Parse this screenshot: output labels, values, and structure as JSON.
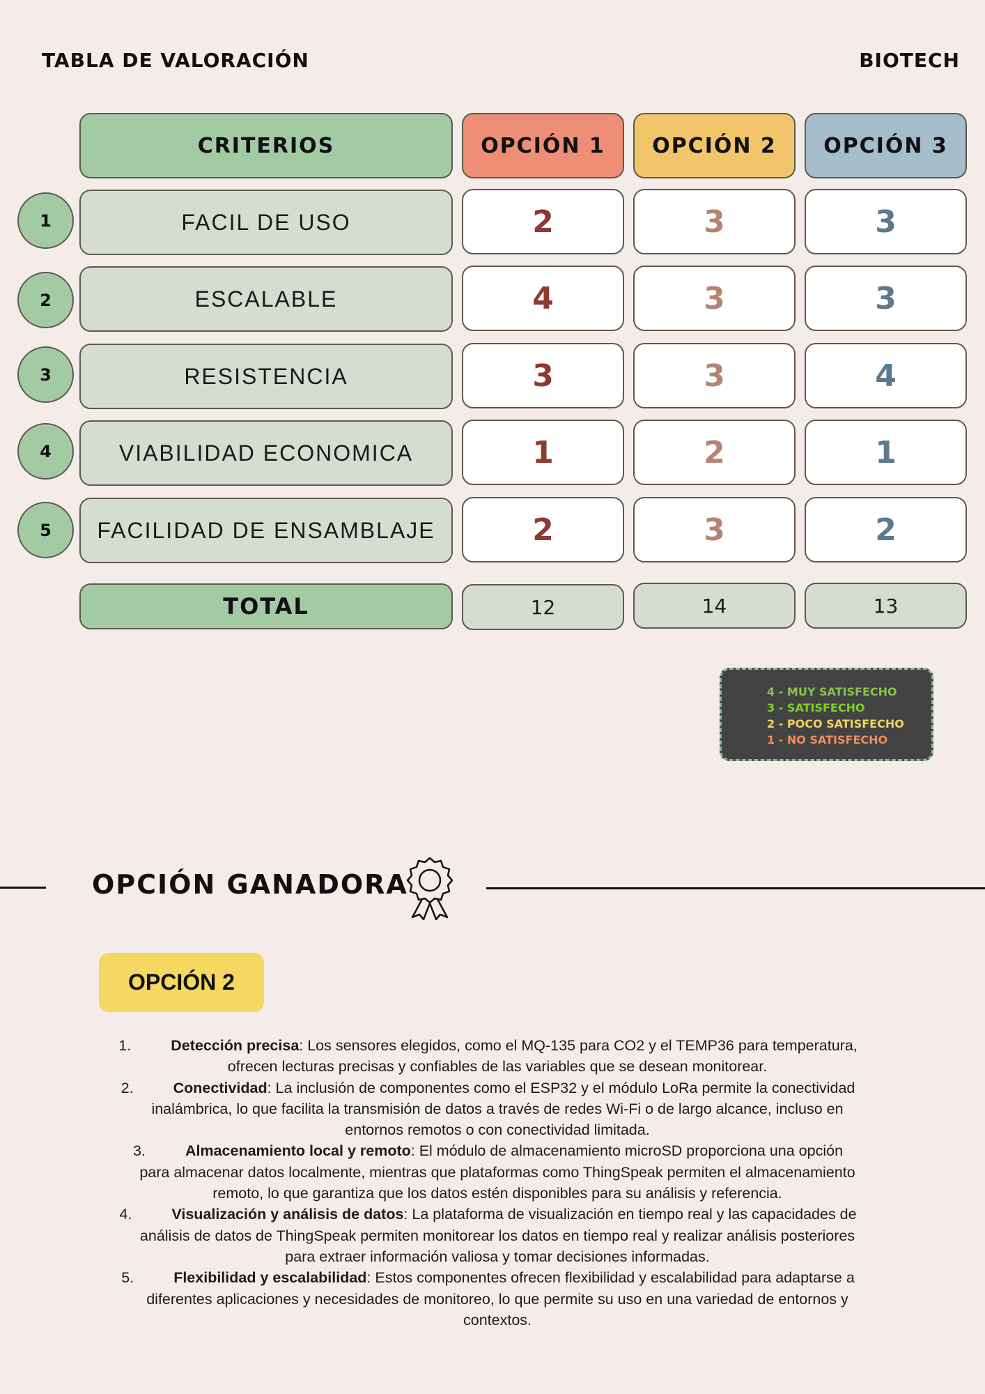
{
  "header": {
    "title": "TABLA DE VALORACIÓN",
    "brand": "BIOTECH"
  },
  "table": {
    "criteria_header": "CRITERIOS",
    "options": [
      {
        "label": "OPCIÓN 1",
        "color": "#ee8e76",
        "value_color": "#8e3a34"
      },
      {
        "label": "OPCIÓN 2",
        "color": "#f3c56b",
        "value_color": "#b48574"
      },
      {
        "label": "OPCIÓN 3",
        "color": "#a6bdcc",
        "value_color": "#5b7a8e"
      }
    ],
    "rows": [
      {
        "num": "1",
        "criterion": "FACIL DE USO",
        "values": [
          "2",
          "3",
          "3"
        ]
      },
      {
        "num": "2",
        "criterion": "ESCALABLE",
        "values": [
          "4",
          "3",
          "3"
        ]
      },
      {
        "num": "3",
        "criterion": "RESISTENCIA",
        "values": [
          "3",
          "3",
          "4"
        ]
      },
      {
        "num": "4",
        "criterion": "VIABILIDAD ECONOMICA",
        "values": [
          "1",
          "2",
          "1"
        ]
      },
      {
        "num": "5",
        "criterion": "FACILIDAD DE ENSAMBLAJE",
        "values": [
          "2",
          "3",
          "2"
        ]
      }
    ],
    "total_label": "TOTAL",
    "totals": [
      "12",
      "14",
      "13"
    ]
  },
  "legend": [
    {
      "text": "4 - MUY SATISFECHO",
      "color": "#8bc34a"
    },
    {
      "text": "3 - SATISFECHO",
      "color": "#7ed321"
    },
    {
      "text": "2 - POCO SATISFECHO",
      "color": "#f4d35e"
    },
    {
      "text": "1 - NO SATISFECHO",
      "color": "#f08c5a"
    }
  ],
  "winner": {
    "section_title": "OPCIÓN GANADORA",
    "icon": "award-ribbon-icon",
    "option_label": "OPCIÓN 2",
    "option_color": "#f4d862",
    "reasons": [
      {
        "num": "1.",
        "title": "Detección precisa",
        "text": ": Los sensores elegidos, como el MQ-135 para CO2 y el TEMP36 para temperatura, ofrecen lecturas precisas y confiables de las variables que se desean monitorear."
      },
      {
        "num": "2.",
        "title": "Conectividad",
        "text": ": La inclusión de componentes como el ESP32 y el módulo LoRa permite la conectividad inalámbrica, lo que facilita la transmisión de datos a través de redes Wi-Fi o de largo alcance, incluso en entornos remotos o con conectividad limitada."
      },
      {
        "num": "3.",
        "title": "Almacenamiento local y remoto",
        "text": ": El módulo de almacenamiento microSD proporciona una opción para almacenar datos localmente, mientras que plataformas como ThingSpeak permiten el almacenamiento remoto, lo que garantiza que los datos estén disponibles para su análisis y referencia."
      },
      {
        "num": "4.",
        "title": "Visualización y análisis de datos",
        "text": ": La plataforma de visualización en tiempo real y las capacidades de análisis de datos de ThingSpeak permiten monitorear los datos en tiempo real y realizar análisis posteriores para extraer información valiosa y tomar decisiones informadas."
      },
      {
        "num": "5.",
        "title": "Flexibilidad y escalabilidad",
        "text": ": Estos componentes ofrecen flexibilidad y escalabilidad para adaptarse a diferentes aplicaciones y necesidades de monitoreo, lo que permite su uso en una variedad de entornos y contextos."
      }
    ]
  }
}
